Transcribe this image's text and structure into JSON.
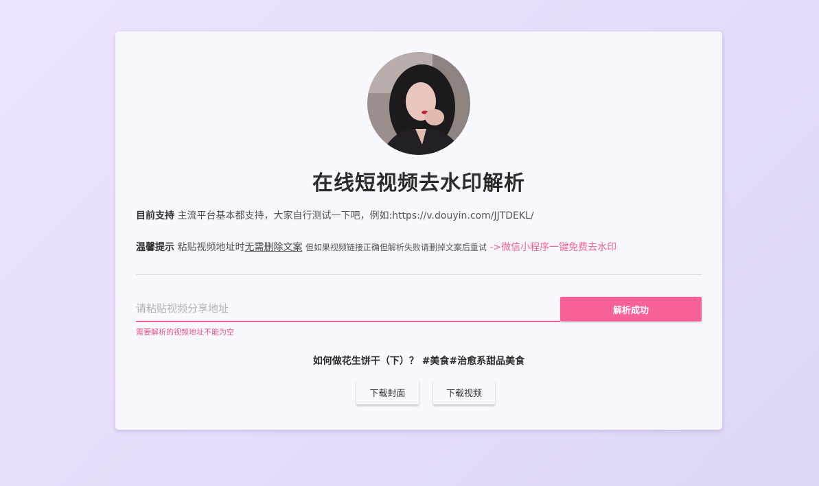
{
  "title": "在线短视频去水印解析",
  "support": {
    "label": "目前支持",
    "text": "主流平台基本都支持，大家自行测试一下吧，例如:https://v.douyin.com/JJTDEKL/"
  },
  "tip": {
    "label": "温馨提示",
    "text_prefix": "粘贴视频地址时",
    "underline_text": "无需删除文案",
    "small_text": "但如果视频链接正确但解析失败请删掉文案后重试",
    "link_text": "->微信小程序一键免费去水印"
  },
  "input": {
    "placeholder": "请粘贴视频分享地址",
    "value": "",
    "error": "需要解析的视频地址不能为空"
  },
  "parse_button": "解析成功",
  "video_title": "如何做花生饼干（下）？ #美食#治愈系甜品美食",
  "download_cover": "下载封面",
  "download_video": "下载视频",
  "colors": {
    "accent": "#f8629a",
    "background": "#e6dcfb",
    "card": "#f8f7fd"
  }
}
